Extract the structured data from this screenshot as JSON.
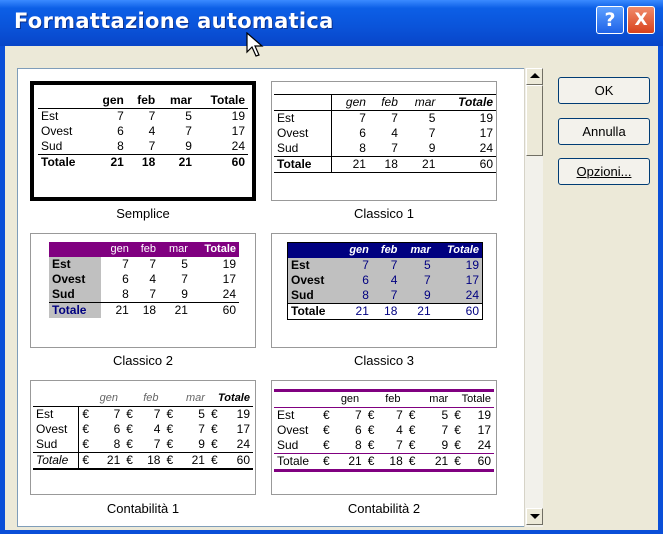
{
  "window": {
    "title": "Formattazione automatica",
    "help_label": "?",
    "close_label": "X"
  },
  "buttons": {
    "ok": "OK",
    "annulla": "Annulla",
    "opzioni": "Opzioni..."
  },
  "formats": [
    {
      "name": "Semplice",
      "header": [
        "",
        "gen",
        "feb",
        "mar",
        "Totale"
      ],
      "rows": [
        [
          "Est",
          "7",
          "7",
          "5",
          "19"
        ],
        [
          "Ovest",
          "6",
          "4",
          "7",
          "17"
        ],
        [
          "Sud",
          "8",
          "7",
          "9",
          "24"
        ]
      ],
      "total": [
        "Totale",
        "21",
        "18",
        "21",
        "60"
      ]
    },
    {
      "name": "Classico 1",
      "header": [
        "",
        "gen",
        "feb",
        "mar",
        "Totale"
      ],
      "rows": [
        [
          "Est",
          "7",
          "7",
          "5",
          "19"
        ],
        [
          "Ovest",
          "6",
          "4",
          "7",
          "17"
        ],
        [
          "Sud",
          "8",
          "7",
          "9",
          "24"
        ]
      ],
      "total": [
        "Totale",
        "21",
        "18",
        "21",
        "60"
      ]
    },
    {
      "name": "Classico 2",
      "header": [
        "",
        "gen",
        "feb",
        "mar",
        "Totale"
      ],
      "rows": [
        [
          "Est",
          "7",
          "7",
          "5",
          "19"
        ],
        [
          "Ovest",
          "6",
          "4",
          "7",
          "17"
        ],
        [
          "Sud",
          "8",
          "7",
          "9",
          "24"
        ]
      ],
      "total": [
        "Totale",
        "21",
        "18",
        "21",
        "60"
      ]
    },
    {
      "name": "Classico 3",
      "header": [
        "",
        "gen",
        "feb",
        "mar",
        "Totale"
      ],
      "rows": [
        [
          "Est",
          "7",
          "7",
          "5",
          "19"
        ],
        [
          "Ovest",
          "6",
          "4",
          "7",
          "17"
        ],
        [
          "Sud",
          "8",
          "7",
          "9",
          "24"
        ]
      ],
      "total": [
        "Totale",
        "21",
        "18",
        "21",
        "60"
      ]
    },
    {
      "name": "Contabilità 1",
      "header": [
        "",
        "gen",
        "feb",
        "mar",
        "Totale"
      ],
      "rows": [
        [
          "Est",
          "€",
          "7",
          "€",
          "7",
          "€",
          "5",
          "€",
          "19"
        ],
        [
          "Ovest",
          "€",
          "6",
          "€",
          "4",
          "€",
          "7",
          "€",
          "17"
        ],
        [
          "Sud",
          "€",
          "8",
          "€",
          "7",
          "€",
          "9",
          "€",
          "24"
        ]
      ],
      "total": [
        "Totale",
        "€",
        "21",
        "€",
        "18",
        "€",
        "21",
        "€",
        "60"
      ]
    },
    {
      "name": "Contabilità 2",
      "header": [
        "",
        "gen",
        "feb",
        "mar",
        "Totale"
      ],
      "rows": [
        [
          "Est",
          "€",
          "7",
          "€",
          "7",
          "€",
          "5",
          "€",
          "19"
        ],
        [
          "Ovest",
          "€",
          "6",
          "€",
          "4",
          "€",
          "7",
          "€",
          "17"
        ],
        [
          "Sud",
          "€",
          "8",
          "€",
          "7",
          "€",
          "9",
          "€",
          "24"
        ]
      ],
      "total": [
        "Totale",
        "€",
        "21",
        "€",
        "18",
        "€",
        "21",
        "€",
        "60"
      ]
    }
  ],
  "colors": {
    "titlebar": "#0a53d9",
    "purple": "#800080",
    "navy": "#000080",
    "gray": "#c0c0c0"
  }
}
